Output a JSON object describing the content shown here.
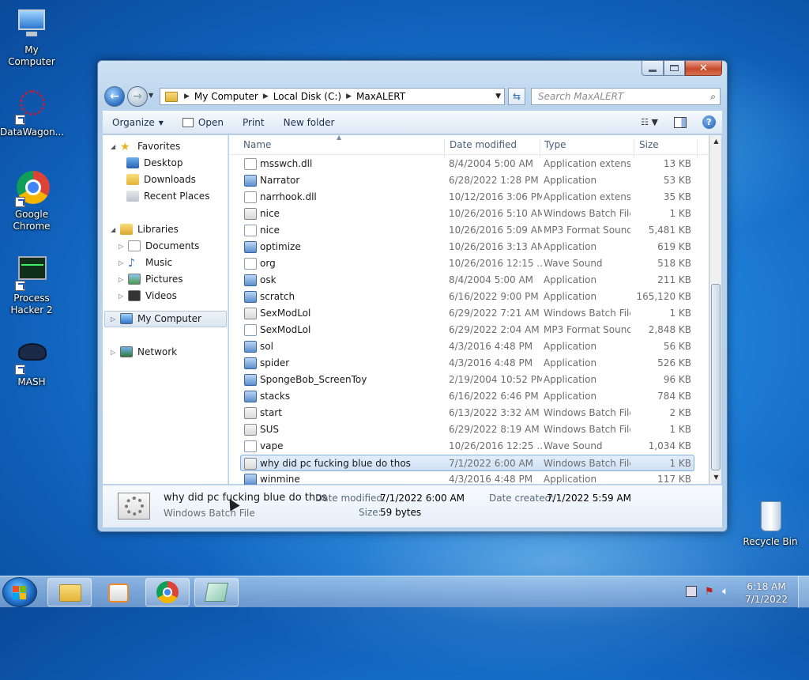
{
  "desktop": {
    "icons": [
      {
        "label": "My Computer"
      },
      {
        "label": "DataWagon..."
      },
      {
        "label": "Google Chrome"
      },
      {
        "label": "Process Hacker 2"
      },
      {
        "label": "MASH"
      },
      {
        "label": "Recycle Bin"
      }
    ]
  },
  "explorer": {
    "address": {
      "crumbs": [
        "My Computer",
        "Local Disk (C:)",
        "MaxALERT"
      ]
    },
    "search": {
      "placeholder": "Search MaxALERT"
    },
    "toolbar": {
      "organize": "Organize",
      "open": "Open",
      "print": "Print",
      "new_folder": "New folder"
    },
    "nav": {
      "favorites": "Favorites",
      "desktop": "Desktop",
      "downloads": "Downloads",
      "recent_places": "Recent Places",
      "libraries": "Libraries",
      "documents": "Documents",
      "music": "Music",
      "pictures": "Pictures",
      "videos": "Videos",
      "my_computer": "My Computer",
      "network": "Network"
    },
    "columns": {
      "name": "Name",
      "date": "Date modified",
      "type": "Type",
      "size": "Size"
    },
    "files": [
      {
        "name": "msswch.dll",
        "date": "8/4/2004 5:00 AM",
        "type": "Application extens...",
        "size": "13 KB",
        "icon": "dll"
      },
      {
        "name": "Narrator",
        "date": "6/28/2022 1:28 PM",
        "type": "Application",
        "size": "53 KB",
        "icon": "app"
      },
      {
        "name": "narrhook.dll",
        "date": "10/12/2016 3:06 PM",
        "type": "Application extens...",
        "size": "35 KB",
        "icon": "dll"
      },
      {
        "name": "nice",
        "date": "10/26/2016 5:10 AM",
        "type": "Windows Batch File",
        "size": "1 KB",
        "icon": "bat"
      },
      {
        "name": "nice",
        "date": "10/26/2016 5:09 AM",
        "type": "MP3 Format Sound",
        "size": "5,481 KB",
        "icon": "mp3"
      },
      {
        "name": "optimize",
        "date": "10/26/2016 3:13 AM",
        "type": "Application",
        "size": "619 KB",
        "icon": "app"
      },
      {
        "name": "org",
        "date": "10/26/2016 12:15 ...",
        "type": "Wave Sound",
        "size": "518 KB",
        "icon": "wav"
      },
      {
        "name": "osk",
        "date": "8/4/2004 5:00 AM",
        "type": "Application",
        "size": "211 KB",
        "icon": "app"
      },
      {
        "name": "scratch",
        "date": "6/16/2022 9:00 PM",
        "type": "Application",
        "size": "165,120 KB",
        "icon": "app"
      },
      {
        "name": "SexModLol",
        "date": "6/29/2022 7:21 AM",
        "type": "Windows Batch File",
        "size": "1 KB",
        "icon": "bat"
      },
      {
        "name": "SexModLol",
        "date": "6/29/2022 2:04 AM",
        "type": "MP3 Format Sound",
        "size": "2,848 KB",
        "icon": "mp3"
      },
      {
        "name": "sol",
        "date": "4/3/2016 4:48 PM",
        "type": "Application",
        "size": "56 KB",
        "icon": "app"
      },
      {
        "name": "spider",
        "date": "4/3/2016 4:48 PM",
        "type": "Application",
        "size": "526 KB",
        "icon": "app"
      },
      {
        "name": "SpongeBob_ScreenToy",
        "date": "2/19/2004 10:52 PM",
        "type": "Application",
        "size": "96 KB",
        "icon": "app"
      },
      {
        "name": "stacks",
        "date": "6/16/2022 6:46 PM",
        "type": "Application",
        "size": "784 KB",
        "icon": "app"
      },
      {
        "name": "start",
        "date": "6/13/2022 3:32 AM",
        "type": "Windows Batch File",
        "size": "2 KB",
        "icon": "bat"
      },
      {
        "name": "SUS",
        "date": "6/29/2022 8:19 AM",
        "type": "Windows Batch File",
        "size": "1 KB",
        "icon": "bat"
      },
      {
        "name": "vape",
        "date": "10/26/2016 12:25 ...",
        "type": "Wave Sound",
        "size": "1,034 KB",
        "icon": "wav"
      },
      {
        "name": "why did pc fucking blue do thos",
        "date": "7/1/2022 6:00 AM",
        "type": "Windows Batch File",
        "size": "1 KB",
        "icon": "bat",
        "selected": true
      },
      {
        "name": "winmine",
        "date": "4/3/2016 4:48 PM",
        "type": "Application",
        "size": "117 KB",
        "icon": "app"
      }
    ],
    "details": {
      "name": "why did pc fucking blue do thos",
      "type": "Windows Batch File",
      "date_modified_label": "Date modified:",
      "date_modified": "7/1/2022 6:00 AM",
      "date_created_label": "Date created:",
      "date_created": "7/1/2022 5:59 AM",
      "size_label": "Size:",
      "size": "59 bytes"
    }
  },
  "taskbar": {
    "time": "6:18 AM",
    "date": "7/1/2022"
  }
}
